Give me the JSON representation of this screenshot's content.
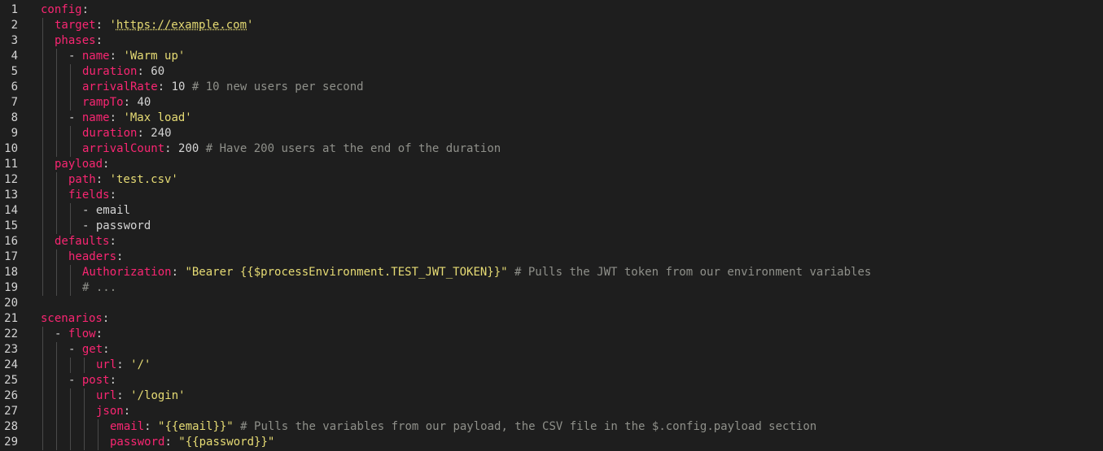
{
  "editor": {
    "lines": [
      {
        "num": "1",
        "indent": 0,
        "tokens": [
          {
            "t": "k",
            "v": "config"
          },
          {
            "t": "p",
            "v": ":"
          }
        ]
      },
      {
        "num": "2",
        "indent": 1,
        "tokens": [
          {
            "t": "k",
            "v": "target"
          },
          {
            "t": "p",
            "v": ": "
          },
          {
            "t": "s",
            "v": "'"
          },
          {
            "t": "u",
            "v": "https://example.com"
          },
          {
            "t": "s",
            "v": "'"
          }
        ]
      },
      {
        "num": "3",
        "indent": 1,
        "tokens": [
          {
            "t": "k",
            "v": "phases"
          },
          {
            "t": "p",
            "v": ":"
          }
        ]
      },
      {
        "num": "4",
        "indent": 2,
        "tokens": [
          {
            "t": "p",
            "v": "- "
          },
          {
            "t": "k",
            "v": "name"
          },
          {
            "t": "p",
            "v": ": "
          },
          {
            "t": "s",
            "v": "'Warm up'"
          }
        ]
      },
      {
        "num": "5",
        "indent": 3,
        "tokens": [
          {
            "t": "k",
            "v": "duration"
          },
          {
            "t": "p",
            "v": ": "
          },
          {
            "t": "n",
            "v": "60"
          }
        ]
      },
      {
        "num": "6",
        "indent": 3,
        "tokens": [
          {
            "t": "k",
            "v": "arrivalRate"
          },
          {
            "t": "p",
            "v": ": "
          },
          {
            "t": "n",
            "v": "10"
          },
          {
            "t": "c",
            "v": " # 10 new users per second"
          }
        ]
      },
      {
        "num": "7",
        "indent": 3,
        "tokens": [
          {
            "t": "k",
            "v": "rampTo"
          },
          {
            "t": "p",
            "v": ": "
          },
          {
            "t": "n",
            "v": "40"
          }
        ]
      },
      {
        "num": "8",
        "indent": 2,
        "tokens": [
          {
            "t": "p",
            "v": "- "
          },
          {
            "t": "k",
            "v": "name"
          },
          {
            "t": "p",
            "v": ": "
          },
          {
            "t": "s",
            "v": "'Max load'"
          }
        ]
      },
      {
        "num": "9",
        "indent": 3,
        "tokens": [
          {
            "t": "k",
            "v": "duration"
          },
          {
            "t": "p",
            "v": ": "
          },
          {
            "t": "n",
            "v": "240"
          }
        ]
      },
      {
        "num": "10",
        "indent": 3,
        "tokens": [
          {
            "t": "k",
            "v": "arrivalCount"
          },
          {
            "t": "p",
            "v": ": "
          },
          {
            "t": "n",
            "v": "200"
          },
          {
            "t": "c",
            "v": " # Have 200 users at the end of the duration"
          }
        ]
      },
      {
        "num": "11",
        "indent": 1,
        "tokens": [
          {
            "t": "k",
            "v": "payload"
          },
          {
            "t": "p",
            "v": ":"
          }
        ]
      },
      {
        "num": "12",
        "indent": 2,
        "tokens": [
          {
            "t": "k",
            "v": "path"
          },
          {
            "t": "p",
            "v": ": "
          },
          {
            "t": "s",
            "v": "'test.csv'"
          }
        ]
      },
      {
        "num": "13",
        "indent": 2,
        "tokens": [
          {
            "t": "k",
            "v": "fields"
          },
          {
            "t": "p",
            "v": ":"
          }
        ]
      },
      {
        "num": "14",
        "indent": 3,
        "tokens": [
          {
            "t": "p",
            "v": "- email"
          }
        ]
      },
      {
        "num": "15",
        "indent": 3,
        "tokens": [
          {
            "t": "p",
            "v": "- password"
          }
        ]
      },
      {
        "num": "16",
        "indent": 1,
        "tokens": [
          {
            "t": "k",
            "v": "defaults"
          },
          {
            "t": "p",
            "v": ":"
          }
        ]
      },
      {
        "num": "17",
        "indent": 2,
        "tokens": [
          {
            "t": "k",
            "v": "headers"
          },
          {
            "t": "p",
            "v": ":"
          }
        ]
      },
      {
        "num": "18",
        "indent": 3,
        "tokens": [
          {
            "t": "k",
            "v": "Authorization"
          },
          {
            "t": "p",
            "v": ": "
          },
          {
            "t": "v",
            "v": "\"Bearer {{$processEnvironment.TEST_JWT_TOKEN}}\""
          },
          {
            "t": "c",
            "v": " # Pulls the JWT token from our environment variables"
          }
        ]
      },
      {
        "num": "19",
        "indent": 3,
        "tokens": [
          {
            "t": "c",
            "v": "# ..."
          }
        ]
      },
      {
        "num": "20",
        "indent": 0,
        "tokens": []
      },
      {
        "num": "21",
        "indent": 0,
        "tokens": [
          {
            "t": "k",
            "v": "scenarios"
          },
          {
            "t": "p",
            "v": ":"
          }
        ]
      },
      {
        "num": "22",
        "indent": 1,
        "tokens": [
          {
            "t": "p",
            "v": "- "
          },
          {
            "t": "k",
            "v": "flow"
          },
          {
            "t": "p",
            "v": ":"
          }
        ]
      },
      {
        "num": "23",
        "indent": 2,
        "tokens": [
          {
            "t": "p",
            "v": "- "
          },
          {
            "t": "k",
            "v": "get"
          },
          {
            "t": "p",
            "v": ":"
          }
        ]
      },
      {
        "num": "24",
        "indent": 4,
        "tokens": [
          {
            "t": "k",
            "v": "url"
          },
          {
            "t": "p",
            "v": ": "
          },
          {
            "t": "s",
            "v": "'/'"
          }
        ]
      },
      {
        "num": "25",
        "indent": 2,
        "tokens": [
          {
            "t": "p",
            "v": "- "
          },
          {
            "t": "k",
            "v": "post"
          },
          {
            "t": "p",
            "v": ":"
          }
        ]
      },
      {
        "num": "26",
        "indent": 4,
        "tokens": [
          {
            "t": "k",
            "v": "url"
          },
          {
            "t": "p",
            "v": ": "
          },
          {
            "t": "s",
            "v": "'/login'"
          }
        ]
      },
      {
        "num": "27",
        "indent": 4,
        "tokens": [
          {
            "t": "k",
            "v": "json"
          },
          {
            "t": "p",
            "v": ":"
          }
        ]
      },
      {
        "num": "28",
        "indent": 5,
        "tokens": [
          {
            "t": "k",
            "v": "email"
          },
          {
            "t": "p",
            "v": ": "
          },
          {
            "t": "v",
            "v": "\"{{email}}\""
          },
          {
            "t": "c",
            "v": " # Pulls the variables from our payload, the CSV file in the $.config.payload section"
          }
        ]
      },
      {
        "num": "29",
        "indent": 5,
        "tokens": [
          {
            "t": "k",
            "v": "password"
          },
          {
            "t": "p",
            "v": ": "
          },
          {
            "t": "v",
            "v": "\"{{password}}\""
          }
        ]
      }
    ]
  }
}
